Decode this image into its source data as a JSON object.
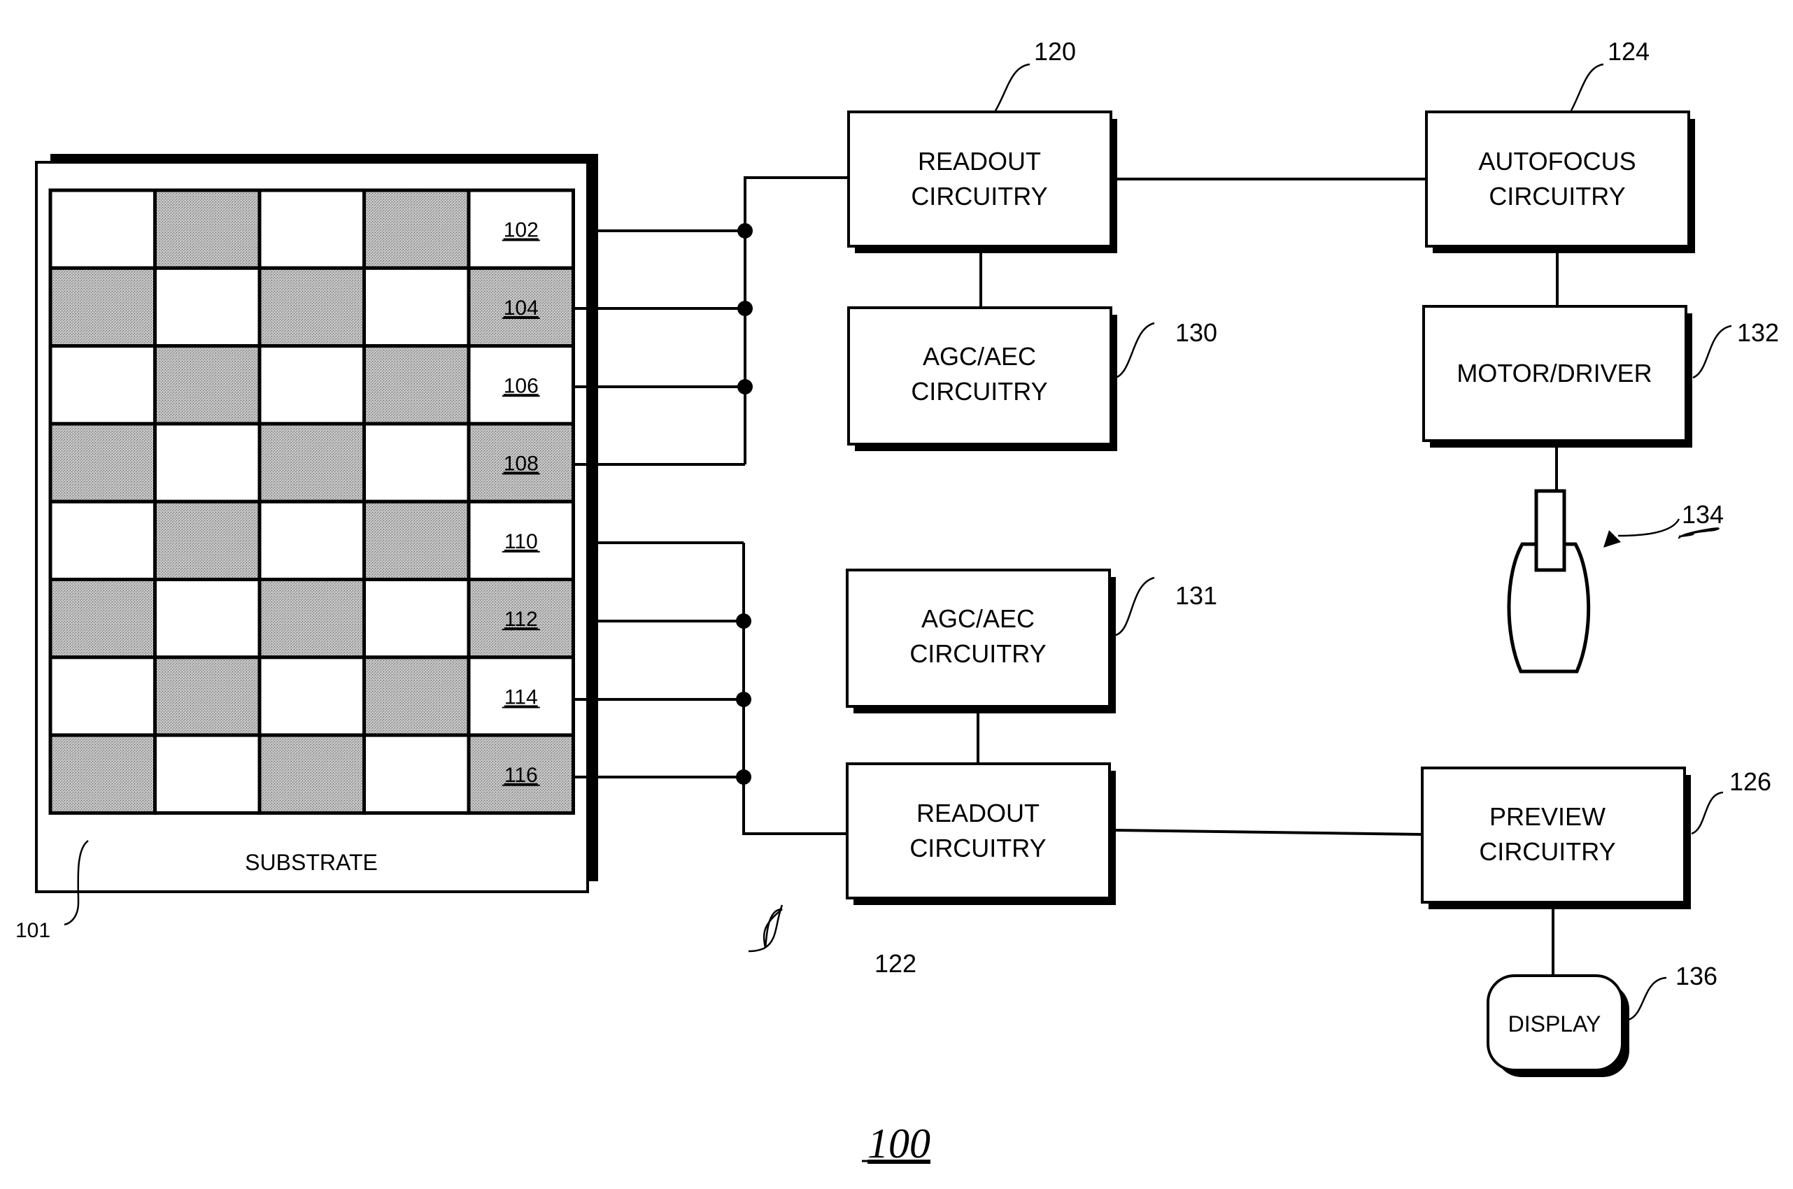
{
  "figure": {
    "label": "100"
  },
  "substrate": {
    "label": "SUBSTRATE",
    "ref": "101",
    "array": {
      "columns": 5,
      "rows": [
        {
          "ref": "102",
          "pattern": [
            "white",
            "gray",
            "white",
            "gray",
            "white"
          ]
        },
        {
          "ref": "104",
          "pattern": [
            "gray",
            "white",
            "gray",
            "white",
            "gray"
          ]
        },
        {
          "ref": "106",
          "pattern": [
            "white",
            "gray",
            "white",
            "gray",
            "white"
          ]
        },
        {
          "ref": "108",
          "pattern": [
            "gray",
            "white",
            "gray",
            "white",
            "gray"
          ]
        },
        {
          "ref": "110",
          "pattern": [
            "white",
            "gray",
            "white",
            "gray",
            "white"
          ]
        },
        {
          "ref": "112",
          "pattern": [
            "gray",
            "white",
            "gray",
            "white",
            "gray"
          ]
        },
        {
          "ref": "114",
          "pattern": [
            "white",
            "gray",
            "white",
            "gray",
            "white"
          ]
        },
        {
          "ref": "116",
          "pattern": [
            "gray",
            "white",
            "gray",
            "white",
            "gray"
          ]
        }
      ]
    }
  },
  "blocks": {
    "readout_120": {
      "ref": "120",
      "lines": [
        "READOUT",
        "CIRCUITRY"
      ]
    },
    "agc_130": {
      "ref": "130",
      "lines": [
        "AGC/AEC",
        "CIRCUITRY"
      ]
    },
    "autofocus_124": {
      "ref": "124",
      "lines": [
        "AUTOFOCUS",
        "CIRCUITRY"
      ]
    },
    "motor_132": {
      "ref": "132",
      "lines": [
        "MOTOR/DRIVER"
      ]
    },
    "lens_134": {
      "ref": "134"
    },
    "agc_131": {
      "ref": "131",
      "lines": [
        "AGC/AEC",
        "CIRCUITRY"
      ]
    },
    "readout_122": {
      "ref": "122",
      "lines": [
        "READOUT",
        "CIRCUITRY"
      ]
    },
    "preview_126": {
      "ref": "126",
      "lines": [
        "PREVIEW",
        "CIRCUITRY"
      ]
    },
    "display_136": {
      "ref": "136",
      "lines": [
        "DISPLAY"
      ]
    }
  },
  "colors": {
    "line": "#000000",
    "background": "#ffffff",
    "pixel_gray": "#b8b8b8"
  }
}
